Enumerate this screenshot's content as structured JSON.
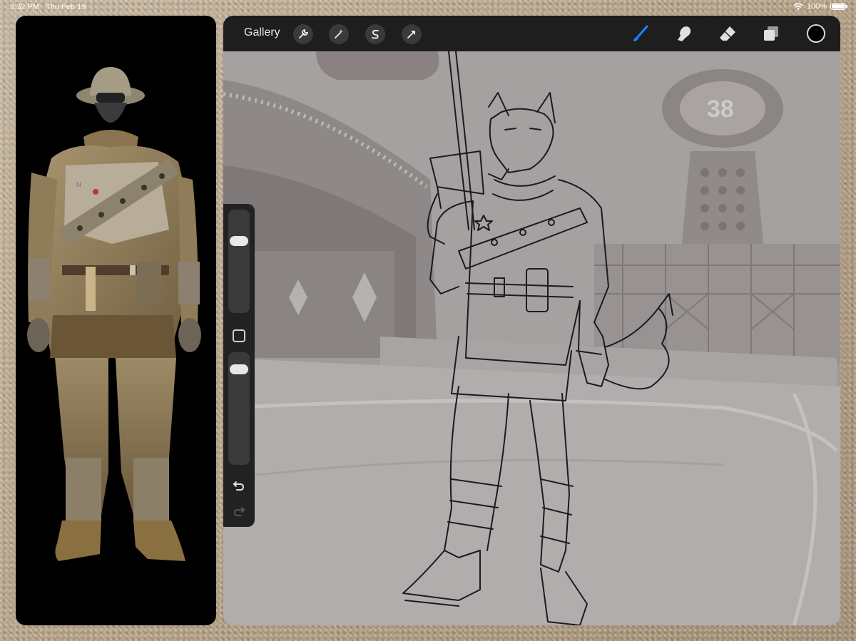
{
  "status_bar": {
    "time": "3:32 PM",
    "date": "Thu Feb 19",
    "battery": "100%",
    "battery_level": 1.0,
    "wifi_icon": "wifi-icon"
  },
  "toolbar": {
    "gallery_label": "Gallery",
    "left_tools": [
      "wrench-icon",
      "magic-wand-icon",
      "selection-s-icon",
      "arrow-transform-icon"
    ],
    "right_tools": [
      "brush-icon",
      "smudge-icon",
      "eraser-icon",
      "layers-icon"
    ],
    "active_tool": "brush-icon",
    "active_color": "#000000",
    "accent_color": "#1a82ff"
  },
  "sidebar": {
    "brush_size_level": 0.72,
    "opacity_level": 0.88,
    "icons": [
      "modify-square-icon",
      "undo-icon",
      "redo-icon"
    ]
  },
  "reference_panel": {
    "background_color": "#000000"
  }
}
